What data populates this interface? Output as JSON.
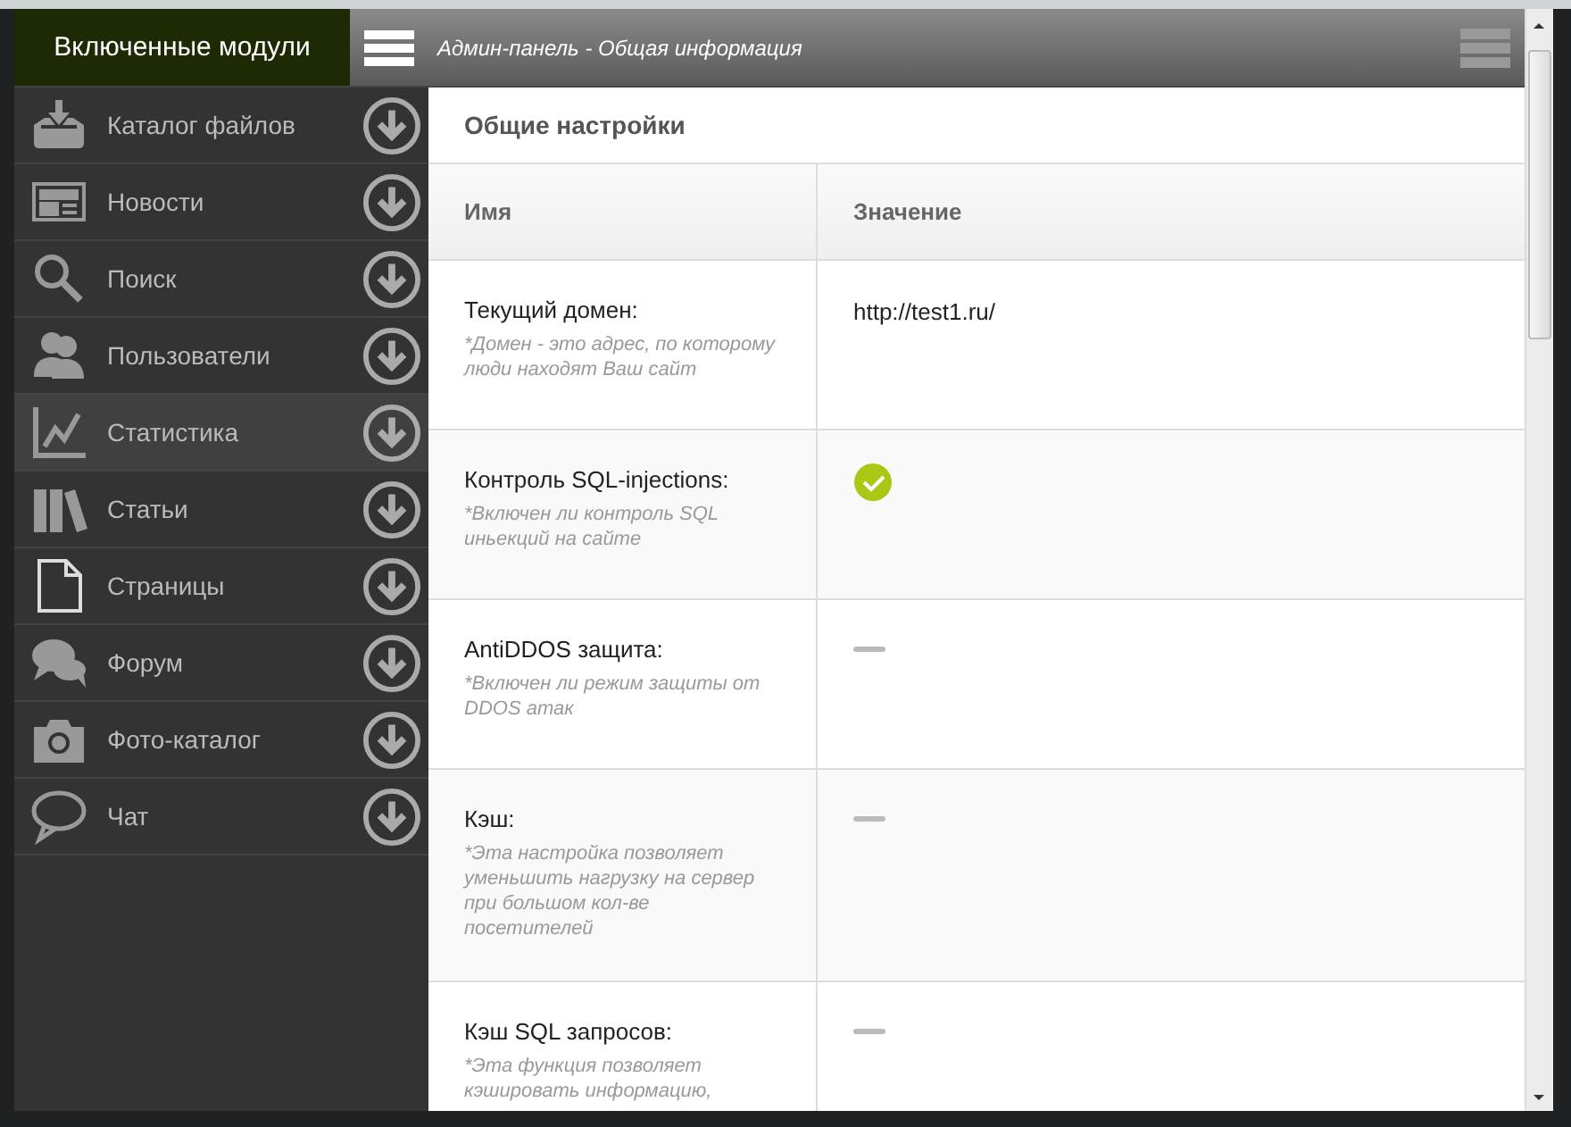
{
  "sidebar": {
    "title": "Включенные модули",
    "items": [
      {
        "label": "Каталог файлов",
        "selected": false
      },
      {
        "label": "Новости",
        "selected": false
      },
      {
        "label": "Поиск",
        "selected": false
      },
      {
        "label": "Пользователи",
        "selected": false
      },
      {
        "label": "Статистика",
        "selected": true
      },
      {
        "label": "Статьи",
        "selected": false
      },
      {
        "label": "Страницы",
        "selected": false
      },
      {
        "label": "Форум",
        "selected": false
      },
      {
        "label": "Фото-каталог",
        "selected": false
      },
      {
        "label": "Чат",
        "selected": false
      }
    ]
  },
  "header": {
    "title": "Админ-панель - Общая информация"
  },
  "section": {
    "title": "Общие настройки"
  },
  "table": {
    "columns": [
      "Имя",
      "Значение"
    ],
    "rows": [
      {
        "label": "Текущий домен:",
        "description": "*Домен - это адрес, по которому люди находят Ваш сайт",
        "kind": "text",
        "value": "http://test1.ru/"
      },
      {
        "label": "Контроль SQL-injections:",
        "description": "*Включен ли контроль SQL иньекций на сайте",
        "kind": "toggle",
        "on": true
      },
      {
        "label": "AntiDDOS защита:",
        "description": "*Включен ли режим защиты от DDOS атак",
        "kind": "toggle",
        "on": false
      },
      {
        "label": "Кэш:",
        "description": "*Эта настройка позволяет уменьшить нагрузку на сервер при большом кол-ве посетителей",
        "kind": "toggle",
        "on": false
      },
      {
        "label": "Кэш SQL запросов:",
        "description": "*Эта функция позволяет кэшировать информацию,",
        "kind": "toggle",
        "on": false
      }
    ]
  }
}
